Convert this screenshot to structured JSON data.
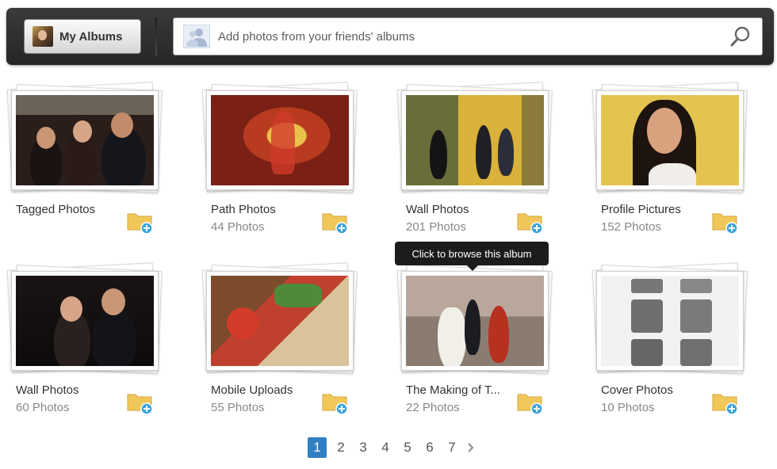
{
  "header": {
    "my_albums_label": "My Albums",
    "search_placeholder": "Add photos from your friends' albums"
  },
  "albums": [
    {
      "title": "Tagged Photos",
      "count": ""
    },
    {
      "title": "Path Photos",
      "count": "44 Photos"
    },
    {
      "title": "Wall Photos",
      "count": "201 Photos"
    },
    {
      "title": "Profile Pictures",
      "count": "152 Photos"
    },
    {
      "title": "Wall Photos",
      "count": "60 Photos"
    },
    {
      "title": "Mobile Uploads",
      "count": "55 Photos"
    },
    {
      "title": "The Making of T...",
      "count": "22 Photos"
    },
    {
      "title": "Cover Photos",
      "count": "10 Photos"
    }
  ],
  "tooltip": "Click to browse this album",
  "pagination": {
    "pages": [
      "1",
      "2",
      "3",
      "4",
      "5",
      "6",
      "7"
    ],
    "current": "1",
    "next_icon": "chevron-right-icon"
  },
  "colors": {
    "topbar": "#2d2d2d",
    "active_page": "#2f7fc2",
    "folder": "#f0c85a",
    "folder_badge": "#3aa3dc"
  }
}
